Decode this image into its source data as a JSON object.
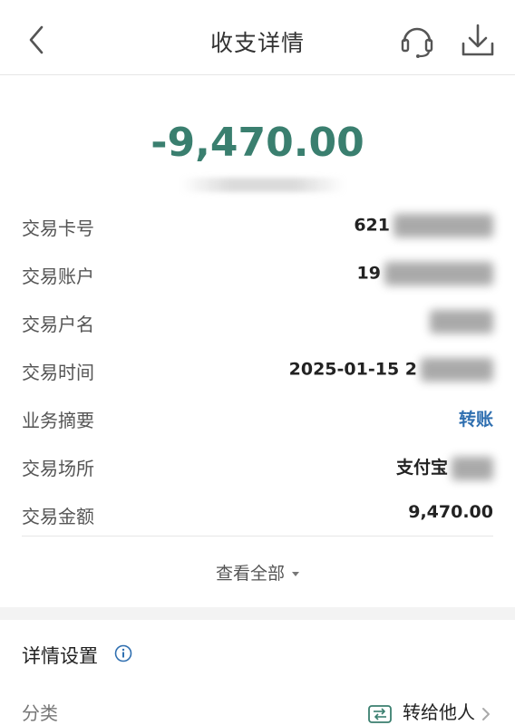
{
  "header": {
    "title": "收支详情"
  },
  "amount": {
    "value": "-9,470.00",
    "color": "#3a7f6f"
  },
  "details": [
    {
      "label": "交易卡号",
      "value": "621"
    },
    {
      "label": "交易账户",
      "value": "19"
    },
    {
      "label": "交易户名",
      "value": ""
    },
    {
      "label": "交易时间",
      "value": "2025-01-15 2"
    },
    {
      "label": "业务摘要",
      "value": "转账"
    },
    {
      "label": "交易场所",
      "value": "支付宝"
    },
    {
      "label": "交易金额",
      "value": "9,470.00"
    }
  ],
  "view_all": {
    "label": "查看全部"
  },
  "settings": {
    "title": "详情设置",
    "category_label": "分类",
    "category_value": "转给他人"
  },
  "colors": {
    "accent_green": "#3a7f6f",
    "link_blue": "#2f6fb0"
  },
  "icons": [
    "back-arrow-icon",
    "headset-icon",
    "download-icon",
    "info-icon",
    "transfer-category-icon",
    "chevron-right-icon"
  ]
}
